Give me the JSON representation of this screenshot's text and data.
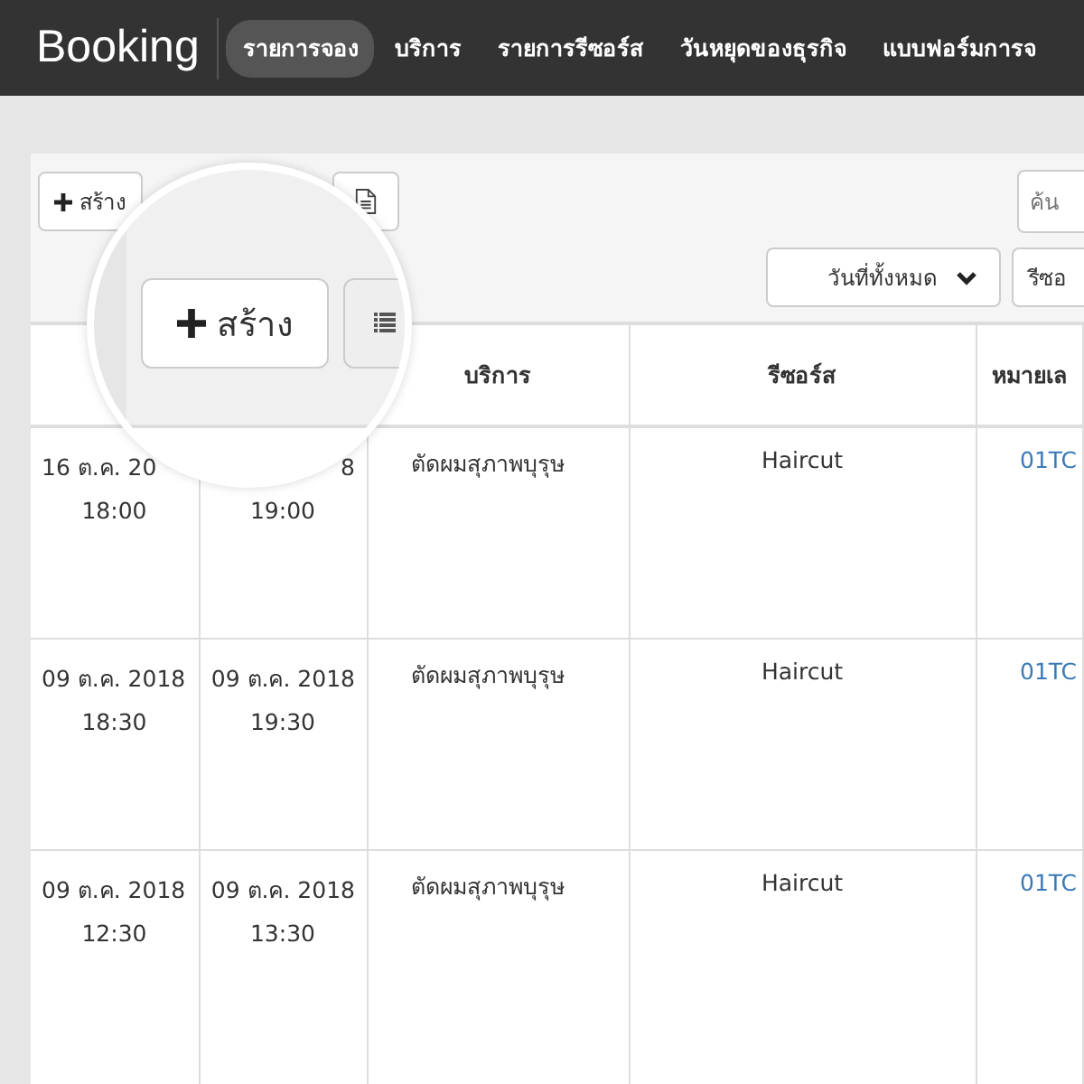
{
  "app": {
    "title": "Booking"
  },
  "nav": [
    {
      "label": "รายการจอง",
      "selected": true
    },
    {
      "label": "บริการ",
      "selected": false
    },
    {
      "label": "รายการรีซอร์ส",
      "selected": false
    },
    {
      "label": "วันหยุดของธุรกิจ",
      "selected": false
    },
    {
      "label": "แบบฟอร์มการจ",
      "selected": false
    }
  ],
  "toolbar": {
    "create_button": "สร้าง",
    "search": {
      "placeholder": "ค้น"
    },
    "filters": [
      "วันที่ทั้งหมด",
      "รีซอ"
    ]
  },
  "table": {
    "columns": [
      "บริการ",
      "รีซอร์ส",
      "หมายเล"
    ],
    "rows": [
      {
        "start": {
          "date": "16 ต.ค. 20",
          "time": "18:00"
        },
        "end": {
          "date": "8",
          "time": "19:00"
        },
        "service": "ตัดผมสุภาพบุรุษ",
        "resource": "Haircut",
        "number": "01TC"
      },
      {
        "start": {
          "date": "09 ต.ค. 2018",
          "time": "18:30"
        },
        "end": {
          "date": "09 ต.ค. 2018",
          "time": "19:30"
        },
        "service": "ตัดผมสุภาพบุรุษ",
        "resource": "Haircut",
        "number": "01TC"
      },
      {
        "start": {
          "date": "09 ต.ค. 2018",
          "time": "12:30"
        },
        "end": {
          "date": "09 ต.ค. 2018",
          "time": "13:30"
        },
        "service": "ตัดผมสุภาพบุรุษ",
        "resource": "Haircut",
        "number": "01TC"
      }
    ]
  },
  "lens": {
    "create_button": "สร้าง"
  }
}
